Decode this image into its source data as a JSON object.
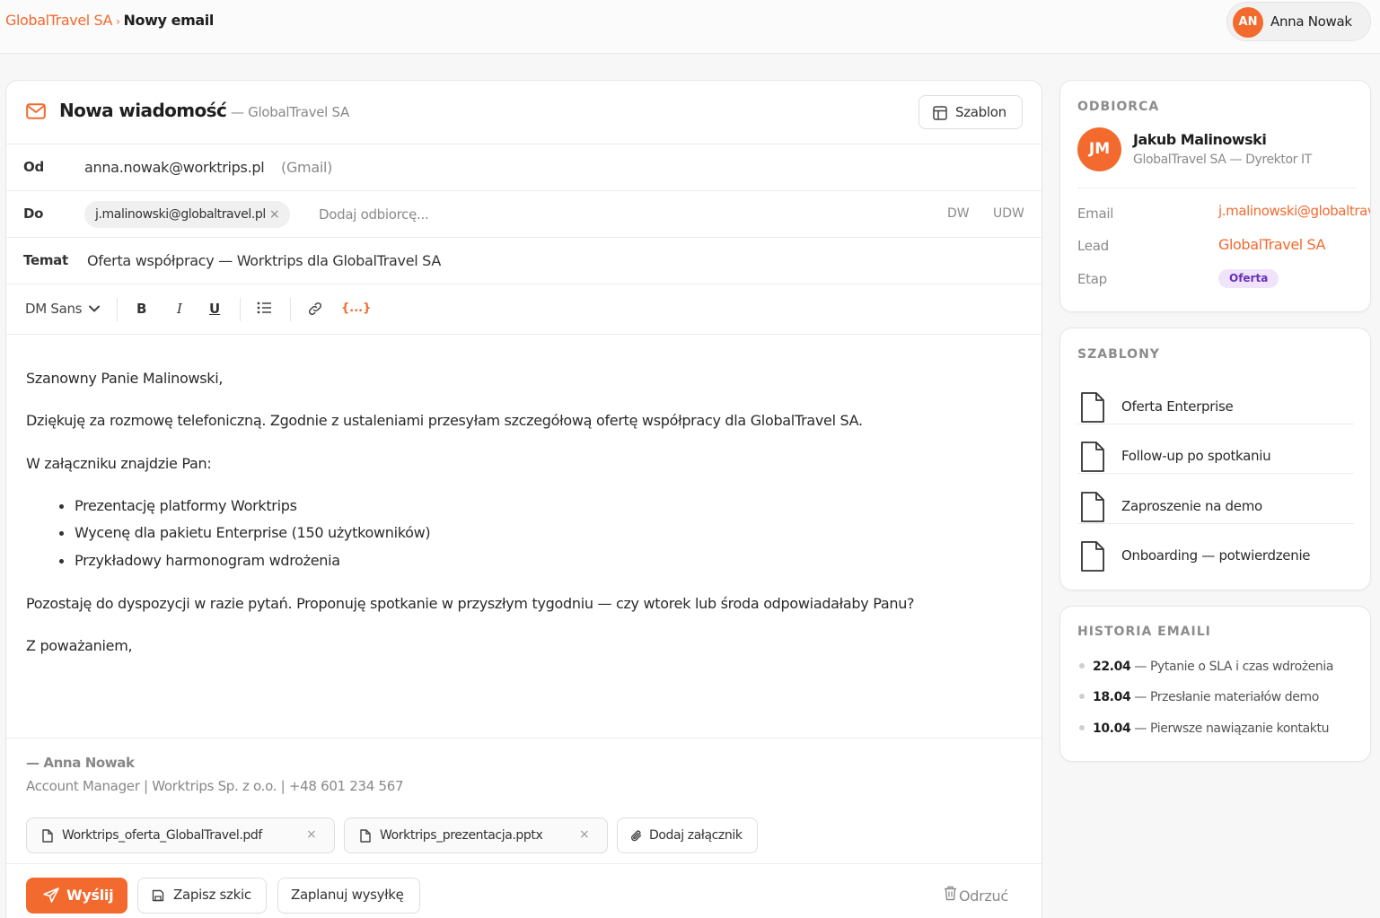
{
  "breadcrumb": {
    "parent": "GlobalTravel SA",
    "separator": "›",
    "current": "Nowy email"
  },
  "user": {
    "initials": "AN",
    "name": "Anna Nowak"
  },
  "colors": {
    "accent": "#f26a2e",
    "stage_bg": "#efe4fb",
    "stage_text": "#6b2fc0"
  },
  "composer": {
    "title": "Nowa wiadomość",
    "subtitle": "— GlobalTravel SA",
    "template_button": "Szablon",
    "from_label": "Od",
    "from_email": "anna.nowak@worktrips.pl",
    "from_provider": "(Gmail)",
    "to_label": "Do",
    "to_recipient": "j.malinowski@globaltravel.pl",
    "to_remove": "×",
    "to_placeholder": "Dodaj odbiorcę...",
    "cc": "DW",
    "bcc": "UDW",
    "subject_label": "Temat",
    "subject": "Oferta współpracy — Worktrips dla GlobalTravel SA",
    "toolbar": {
      "font": "DM Sans",
      "bold": "B",
      "italic": "I",
      "underline": "U",
      "variables": "{...}"
    },
    "body": {
      "greeting": "Szanowny Panie Malinowski,",
      "p1": "Dziękuję za rozmowę telefoniczną. Zgodnie z ustaleniami przesyłam szczegółową ofertę współpracy dla GlobalTravel SA.",
      "p2": "W załączniku znajdzie Pan:",
      "items": [
        "Prezentację platformy Worktrips",
        "Wycenę dla pakietu Enterprise (150 użytkowników)",
        "Przykładowy harmonogram wdrożenia"
      ],
      "p3": "Pozostaję do dyspozycji w razie pytań. Proponuję spotkanie w przyszłym tygodniu — czy wtorek lub środa odpowiadałaby Panu?",
      "closing": "Z poważaniem,"
    },
    "signature": {
      "name": "— Anna Nowak",
      "details": "Account Manager | Worktrips Sp. z o.o. | +48 601 234 567"
    },
    "attachments": [
      {
        "name": "Worktrips_oferta_GlobalTravel.pdf",
        "remove": "×"
      },
      {
        "name": "Worktrips_prezentacja.pptx",
        "remove": "×"
      }
    ],
    "add_attachment": "Dodaj załącznik",
    "send": "Wyślij",
    "save_draft": "Zapisz szkic",
    "schedule": "Zaplanuj wysyłkę",
    "discard": "Odrzuć"
  },
  "recipient_card": {
    "title": "ODBIORCA",
    "initials": "JM",
    "name": "Jakub Malinowski",
    "role": "GlobalTravel SA — Dyrektor IT",
    "email_label": "Email",
    "email": "j.malinowski@globaltravel.pl",
    "lead_label": "Lead",
    "lead": "GlobalTravel SA",
    "stage_label": "Etap",
    "stage": "Oferta"
  },
  "templates_card": {
    "title": "SZABLONY",
    "items": [
      "Oferta Enterprise",
      "Follow-up po spotkaniu",
      "Zaproszenie na demo",
      "Onboarding — potwierdzenie"
    ]
  },
  "history_card": {
    "title": "HISTORIA EMAILI",
    "items": [
      {
        "date": "22.04",
        "text": "— Pytanie o SLA i czas wdrożenia"
      },
      {
        "date": "18.04",
        "text": "— Przesłanie materiałów demo"
      },
      {
        "date": "10.04",
        "text": "— Pierwsze nawiązanie kontaktu"
      }
    ]
  }
}
